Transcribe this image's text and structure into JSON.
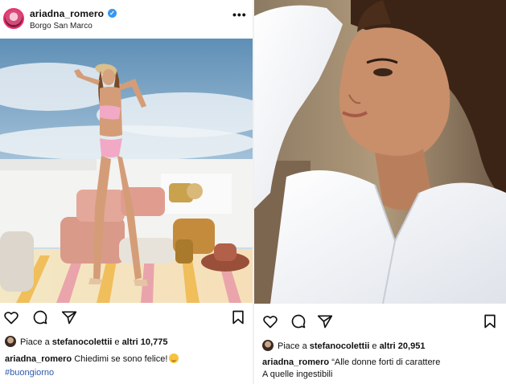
{
  "left_post": {
    "username": "ariadna_romero",
    "verified_icon": "verified-badge-icon",
    "location": "Borgo San Marco",
    "more_label": "•••",
    "likes_prefix": "Piace a ",
    "likes_user": "stefanocolettii",
    "likes_mid": " e ",
    "likes_count": "altri 10,775",
    "caption_user": "ariadna_romero",
    "caption_text": " Chiedimi se sono felice!",
    "caption_hashtag": "#buongiorno",
    "icons": [
      "heart-icon",
      "comment-icon",
      "share-icon",
      "bookmark-icon"
    ]
  },
  "right_post": {
    "likes_prefix": "Piace a ",
    "likes_user": "stefanocolettii",
    "likes_mid": " e ",
    "likes_count": "altri 20,951",
    "caption_user": "ariadna_romero",
    "caption_text": " “Alle donne forti di carattere",
    "caption_line2": "A quelle ingestibili",
    "icons": [
      "heart-icon",
      "comment-icon",
      "share-icon",
      "bookmark-icon"
    ]
  }
}
